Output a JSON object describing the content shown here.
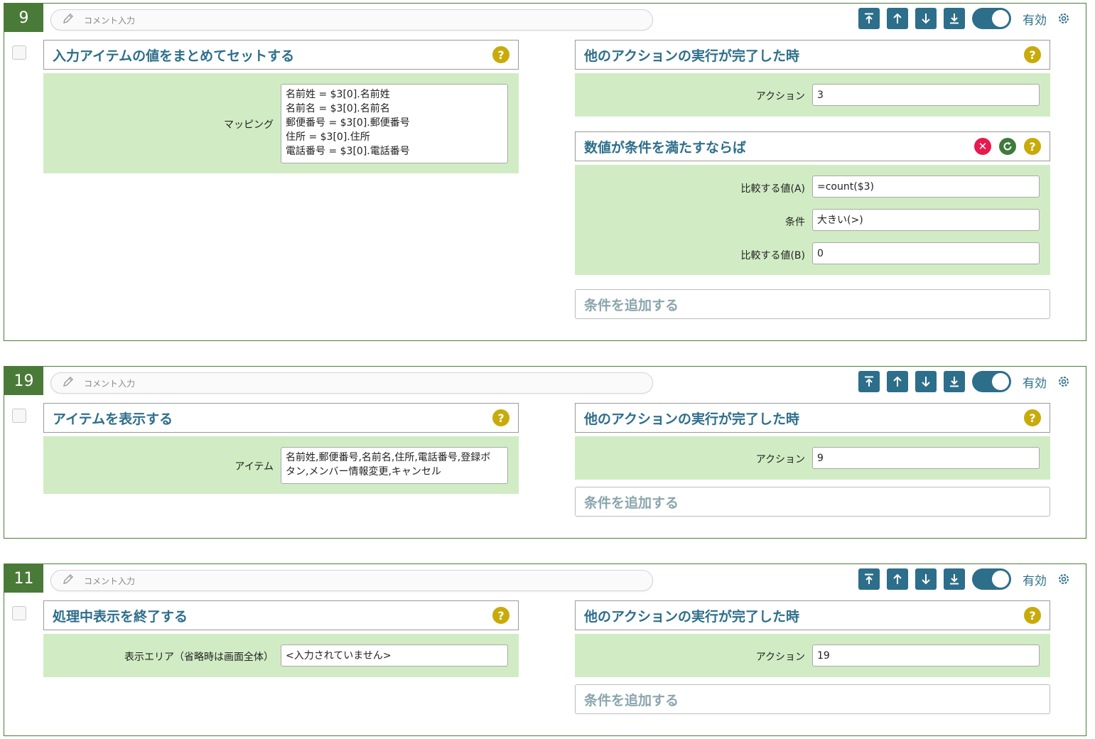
{
  "ui": {
    "comment_placeholder": "コメント入力",
    "enabled_label": "有効",
    "help_mark": "?",
    "delete_mark": "✕"
  },
  "cards": [
    {
      "number": "9",
      "left_panel": {
        "title": "入力アイテムの値をまとめてセットする",
        "field_label": "マッピング",
        "field_lines": [
          "名前姓 = $3[0].名前姓",
          "名前名 = $3[0].名前名",
          "郵便番号 = $3[0].郵便番号",
          "住所 = $3[0].住所",
          "電話番号 = $3[0].電話番号"
        ]
      },
      "trigger": {
        "title": "他のアクションの実行が完了した時",
        "label": "アクション",
        "value": "3"
      },
      "condition": {
        "title": "数値が条件を満たすならば",
        "rows": [
          {
            "label": "比較する値(A)",
            "value": "=count($3)"
          },
          {
            "label": "条件",
            "value": "大きい(>)"
          },
          {
            "label": "比較する値(B)",
            "value": "0"
          }
        ]
      },
      "add_condition": "条件を追加する"
    },
    {
      "number": "19",
      "left_panel": {
        "title": "アイテムを表示する",
        "field_label": "アイテム",
        "field_lines": [
          "名前姓,郵便番号,名前名,住所,電話番号,登録ボ",
          "タン,メンバー情報変更,キャンセル"
        ]
      },
      "trigger": {
        "title": "他のアクションの実行が完了した時",
        "label": "アクション",
        "value": "9"
      },
      "add_condition": "条件を追加する"
    },
    {
      "number": "11",
      "left_panel": {
        "title": "処理中表示を終了する",
        "field_label": "表示エリア（省略時は画面全体）",
        "field_value": "<入力されていません>"
      },
      "trigger": {
        "title": "他のアクションの実行が完了した時",
        "label": "アクション",
        "value": "19"
      },
      "add_condition": "条件を追加する"
    }
  ],
  "colors": {
    "accent": "#2d6e8a",
    "card_border": "#4f7c3a",
    "number_bg": "#4a7a38",
    "panel_bg": "#d1ecc4",
    "help": "#c8ab0b",
    "delete": "#e8194f",
    "refresh": "#3f7a3c"
  },
  "icons": [
    "pencil-icon",
    "move-top-icon",
    "arrow-up-icon",
    "arrow-down-icon",
    "move-bottom-icon",
    "gear-icon",
    "help-icon",
    "delete-icon",
    "refresh-icon"
  ]
}
